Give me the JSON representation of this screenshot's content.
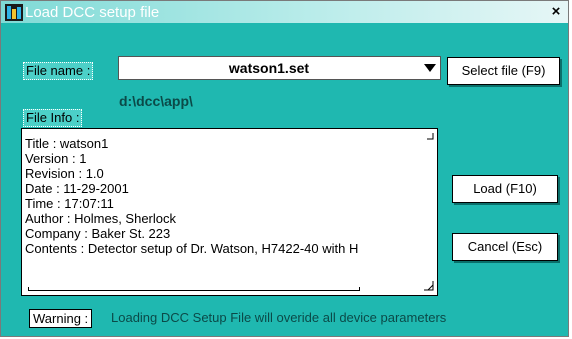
{
  "window": {
    "title": "Load DCC setup file",
    "close_label": "×"
  },
  "file": {
    "name_label": "File name :",
    "selected_file": "watson1.set",
    "path": "d:\\dcc\\app\\",
    "info_label": "File Info :"
  },
  "info_lines": [
    "Title : watson1",
    "Version : 1",
    "Revision : 1.0",
    "Date : 11-29-2001",
    "Time : 17:07:11",
    "Author : Holmes, Sherlock",
    "Company : Baker St. 223",
    "Contents : Detector setup of Dr. Watson, H7422-40 with H"
  ],
  "buttons": {
    "select_file": "Select file (F9)",
    "load": "Load (F10)",
    "cancel": "Cancel (Esc)"
  },
  "warning": {
    "label": "Warning :",
    "text": "Loading DCC Setup  File will overide all device parameters"
  },
  "colors": {
    "background": "#1fb8b0",
    "titlebar": "#7fdad6"
  }
}
